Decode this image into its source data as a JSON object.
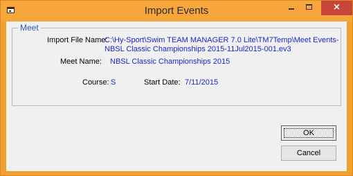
{
  "window": {
    "title": "Import Events",
    "close_glyph": "×"
  },
  "meet_group": {
    "label": "Meet",
    "import_file_label": "Import File Name:",
    "import_file_value": "C:\\Hy-Sport\\Swim TEAM MANAGER 7.0 Lite\\TM7Temp\\Meet Events-NBSL Classic Championships 2015-11Jul2015-001.ev3",
    "meet_name_label": "Meet Name:",
    "meet_name_value": "NBSL Classic Championships 2015",
    "course_label": "Course:",
    "course_value": "S",
    "start_date_label": "Start Date:",
    "start_date_value": "7/11/2015"
  },
  "buttons": {
    "ok_label": "OK",
    "cancel_label": "Cancel"
  },
  "colors": {
    "title_bar": "#f6a63a",
    "group_label": "#2a57b8",
    "value_text": "#1a27c8",
    "close_button": "#c7463b"
  },
  "icons": {
    "app": "app-window-icon",
    "minimize": "minimize-icon",
    "maximize": "maximize-icon",
    "close": "close-icon"
  }
}
